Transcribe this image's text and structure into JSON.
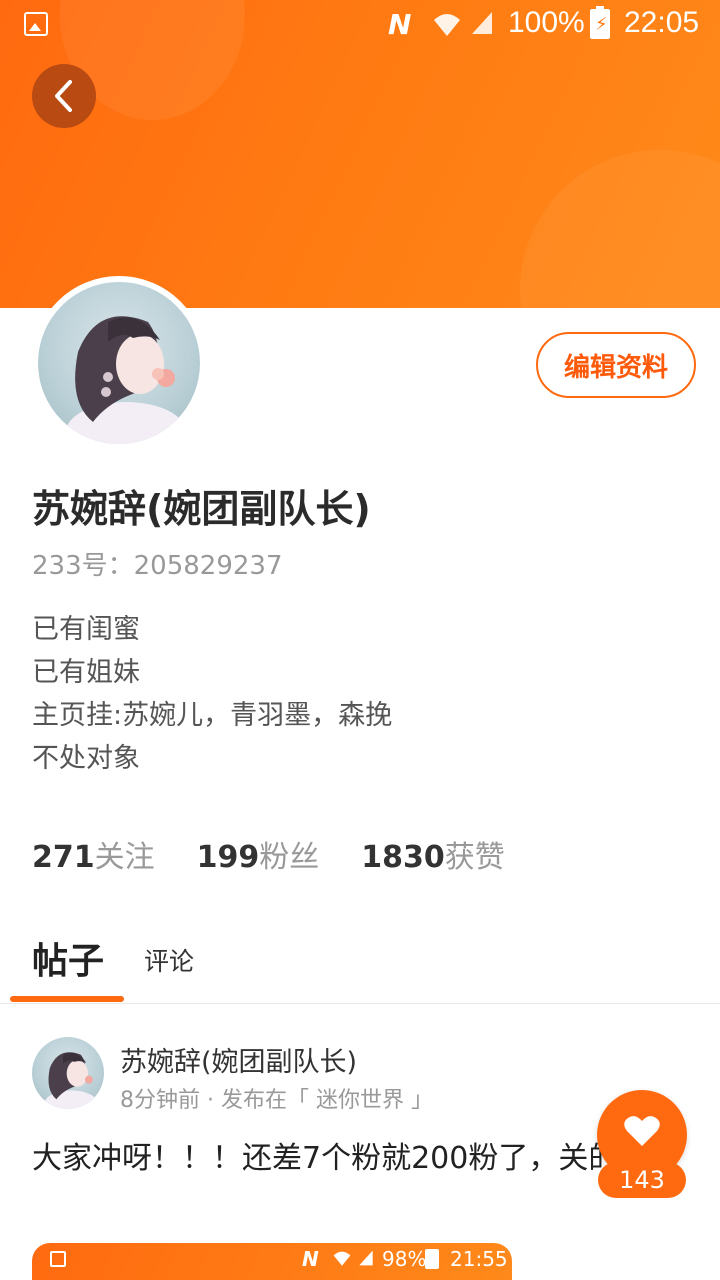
{
  "status_bar": {
    "battery_percent": "100%",
    "time": "22:05",
    "nfc": "N"
  },
  "colors": {
    "accent": "#ff6a10",
    "back_button": "#b84a12"
  },
  "header": {
    "back_icon": "chevron-left-icon"
  },
  "profile": {
    "edit_label": "编辑资料",
    "name": "苏婉辞(婉团副队长)",
    "id_line": "233号：205829237",
    "bio": [
      "已有闺蜜",
      "已有姐妹",
      "主页挂:苏婉儿，青羽墨，森挽",
      "不处对象"
    ],
    "stats": [
      {
        "num": "271",
        "label": "关注"
      },
      {
        "num": "199",
        "label": "粉丝"
      },
      {
        "num": "1830",
        "label": "获赞"
      }
    ]
  },
  "tabs": {
    "posts": "帖子",
    "comments": "评论"
  },
  "post": {
    "author": "苏婉辞(婉团副队长)",
    "meta": "8分钟前 · 发布在「 迷你世界 」",
    "text": "大家冲呀！！！还差7个粉就200粉了，关的",
    "likes": "143",
    "image_status": {
      "nfc": "N",
      "battery_percent": "98%",
      "time": "21:55"
    }
  }
}
